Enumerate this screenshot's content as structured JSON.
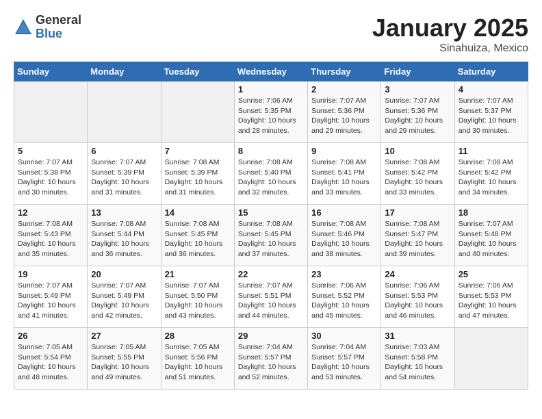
{
  "logo": {
    "general": "General",
    "blue": "Blue"
  },
  "title": "January 2025",
  "subtitle": "Sinahuiza, Mexico",
  "days_header": [
    "Sunday",
    "Monday",
    "Tuesday",
    "Wednesday",
    "Thursday",
    "Friday",
    "Saturday"
  ],
  "weeks": [
    [
      {
        "day": "",
        "sunrise": "",
        "sunset": "",
        "daylight": ""
      },
      {
        "day": "",
        "sunrise": "",
        "sunset": "",
        "daylight": ""
      },
      {
        "day": "",
        "sunrise": "",
        "sunset": "",
        "daylight": ""
      },
      {
        "day": "1",
        "sunrise": "Sunrise: 7:06 AM",
        "sunset": "Sunset: 5:35 PM",
        "daylight": "Daylight: 10 hours and 28 minutes."
      },
      {
        "day": "2",
        "sunrise": "Sunrise: 7:07 AM",
        "sunset": "Sunset: 5:36 PM",
        "daylight": "Daylight: 10 hours and 29 minutes."
      },
      {
        "day": "3",
        "sunrise": "Sunrise: 7:07 AM",
        "sunset": "Sunset: 5:36 PM",
        "daylight": "Daylight: 10 hours and 29 minutes."
      },
      {
        "day": "4",
        "sunrise": "Sunrise: 7:07 AM",
        "sunset": "Sunset: 5:37 PM",
        "daylight": "Daylight: 10 hours and 30 minutes."
      }
    ],
    [
      {
        "day": "5",
        "sunrise": "Sunrise: 7:07 AM",
        "sunset": "Sunset: 5:38 PM",
        "daylight": "Daylight: 10 hours and 30 minutes."
      },
      {
        "day": "6",
        "sunrise": "Sunrise: 7:07 AM",
        "sunset": "Sunset: 5:39 PM",
        "daylight": "Daylight: 10 hours and 31 minutes."
      },
      {
        "day": "7",
        "sunrise": "Sunrise: 7:08 AM",
        "sunset": "Sunset: 5:39 PM",
        "daylight": "Daylight: 10 hours and 31 minutes."
      },
      {
        "day": "8",
        "sunrise": "Sunrise: 7:08 AM",
        "sunset": "Sunset: 5:40 PM",
        "daylight": "Daylight: 10 hours and 32 minutes."
      },
      {
        "day": "9",
        "sunrise": "Sunrise: 7:08 AM",
        "sunset": "Sunset: 5:41 PM",
        "daylight": "Daylight: 10 hours and 33 minutes."
      },
      {
        "day": "10",
        "sunrise": "Sunrise: 7:08 AM",
        "sunset": "Sunset: 5:42 PM",
        "daylight": "Daylight: 10 hours and 33 minutes."
      },
      {
        "day": "11",
        "sunrise": "Sunrise: 7:08 AM",
        "sunset": "Sunset: 5:42 PM",
        "daylight": "Daylight: 10 hours and 34 minutes."
      }
    ],
    [
      {
        "day": "12",
        "sunrise": "Sunrise: 7:08 AM",
        "sunset": "Sunset: 5:43 PM",
        "daylight": "Daylight: 10 hours and 35 minutes."
      },
      {
        "day": "13",
        "sunrise": "Sunrise: 7:08 AM",
        "sunset": "Sunset: 5:44 PM",
        "daylight": "Daylight: 10 hours and 36 minutes."
      },
      {
        "day": "14",
        "sunrise": "Sunrise: 7:08 AM",
        "sunset": "Sunset: 5:45 PM",
        "daylight": "Daylight: 10 hours and 36 minutes."
      },
      {
        "day": "15",
        "sunrise": "Sunrise: 7:08 AM",
        "sunset": "Sunset: 5:45 PM",
        "daylight": "Daylight: 10 hours and 37 minutes."
      },
      {
        "day": "16",
        "sunrise": "Sunrise: 7:08 AM",
        "sunset": "Sunset: 5:46 PM",
        "daylight": "Daylight: 10 hours and 38 minutes."
      },
      {
        "day": "17",
        "sunrise": "Sunrise: 7:08 AM",
        "sunset": "Sunset: 5:47 PM",
        "daylight": "Daylight: 10 hours and 39 minutes."
      },
      {
        "day": "18",
        "sunrise": "Sunrise: 7:07 AM",
        "sunset": "Sunset: 5:48 PM",
        "daylight": "Daylight: 10 hours and 40 minutes."
      }
    ],
    [
      {
        "day": "19",
        "sunrise": "Sunrise: 7:07 AM",
        "sunset": "Sunset: 5:49 PM",
        "daylight": "Daylight: 10 hours and 41 minutes."
      },
      {
        "day": "20",
        "sunrise": "Sunrise: 7:07 AM",
        "sunset": "Sunset: 5:49 PM",
        "daylight": "Daylight: 10 hours and 42 minutes."
      },
      {
        "day": "21",
        "sunrise": "Sunrise: 7:07 AM",
        "sunset": "Sunset: 5:50 PM",
        "daylight": "Daylight: 10 hours and 43 minutes."
      },
      {
        "day": "22",
        "sunrise": "Sunrise: 7:07 AM",
        "sunset": "Sunset: 5:51 PM",
        "daylight": "Daylight: 10 hours and 44 minutes."
      },
      {
        "day": "23",
        "sunrise": "Sunrise: 7:06 AM",
        "sunset": "Sunset: 5:52 PM",
        "daylight": "Daylight: 10 hours and 45 minutes."
      },
      {
        "day": "24",
        "sunrise": "Sunrise: 7:06 AM",
        "sunset": "Sunset: 5:53 PM",
        "daylight": "Daylight: 10 hours and 46 minutes."
      },
      {
        "day": "25",
        "sunrise": "Sunrise: 7:06 AM",
        "sunset": "Sunset: 5:53 PM",
        "daylight": "Daylight: 10 hours and 47 minutes."
      }
    ],
    [
      {
        "day": "26",
        "sunrise": "Sunrise: 7:05 AM",
        "sunset": "Sunset: 5:54 PM",
        "daylight": "Daylight: 10 hours and 48 minutes."
      },
      {
        "day": "27",
        "sunrise": "Sunrise: 7:05 AM",
        "sunset": "Sunset: 5:55 PM",
        "daylight": "Daylight: 10 hours and 49 minutes."
      },
      {
        "day": "28",
        "sunrise": "Sunrise: 7:05 AM",
        "sunset": "Sunset: 5:56 PM",
        "daylight": "Daylight: 10 hours and 51 minutes."
      },
      {
        "day": "29",
        "sunrise": "Sunrise: 7:04 AM",
        "sunset": "Sunset: 5:57 PM",
        "daylight": "Daylight: 10 hours and 52 minutes."
      },
      {
        "day": "30",
        "sunrise": "Sunrise: 7:04 AM",
        "sunset": "Sunset: 5:57 PM",
        "daylight": "Daylight: 10 hours and 53 minutes."
      },
      {
        "day": "31",
        "sunrise": "Sunrise: 7:03 AM",
        "sunset": "Sunset: 5:58 PM",
        "daylight": "Daylight: 10 hours and 54 minutes."
      },
      {
        "day": "",
        "sunrise": "",
        "sunset": "",
        "daylight": ""
      }
    ]
  ]
}
